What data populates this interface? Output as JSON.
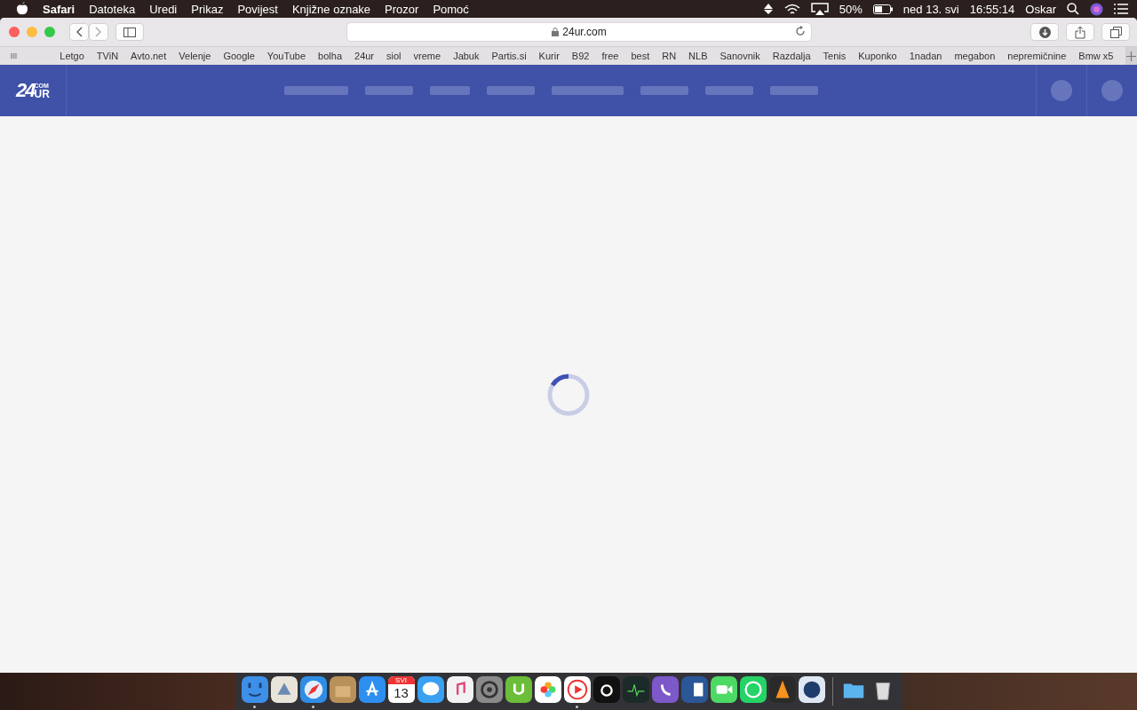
{
  "menu_bar": {
    "app_name": "Safari",
    "menus": [
      "Datoteka",
      "Uredi",
      "Prikaz",
      "Povijest",
      "Knjižne oznake",
      "Prozor",
      "Pomoć"
    ],
    "battery_percent": "50%",
    "date": "ned 13. svi",
    "time": "16:55:14",
    "user": "Oskar"
  },
  "toolbar": {
    "address": "24ur.com"
  },
  "bookmarks": [
    "Letgo",
    "TViN",
    "Avto.net",
    "Velenje",
    "Google",
    "YouTube",
    "bolha",
    "24ur",
    "siol",
    "vreme",
    "Jabuk",
    "Partis.si",
    "Kurir",
    "B92",
    "free",
    "best",
    "RN",
    "NLB",
    "Sanovnik",
    "Razdalja",
    "Tenis",
    "Kuponko",
    "1nadan",
    "megabon",
    "nepremičnine",
    "Bmw x5"
  ],
  "site_header": {
    "logo_number": "24",
    "logo_com": "COM",
    "logo_ur": "UR"
  },
  "loading": true,
  "dock": [
    {
      "kind": "finder",
      "running": true
    },
    {
      "kind": "mail",
      "running": false
    },
    {
      "kind": "safari",
      "running": true
    },
    {
      "kind": "archive",
      "running": false
    },
    {
      "kind": "appstore",
      "running": false
    },
    {
      "kind": "calendar",
      "running": false,
      "month": "SVI",
      "day": "13"
    },
    {
      "kind": "messages",
      "running": false
    },
    {
      "kind": "music",
      "running": false
    },
    {
      "kind": "settings",
      "running": false
    },
    {
      "kind": "torrent",
      "running": false
    },
    {
      "kind": "photos",
      "running": false
    },
    {
      "kind": "player",
      "running": true
    },
    {
      "kind": "camera",
      "running": false
    },
    {
      "kind": "monitor",
      "running": false
    },
    {
      "kind": "viber",
      "running": false
    },
    {
      "kind": "word",
      "running": false
    },
    {
      "kind": "facetime",
      "running": false
    },
    {
      "kind": "whatsapp",
      "running": false
    },
    {
      "kind": "vlc",
      "running": false
    },
    {
      "kind": "network",
      "running": false
    },
    {
      "kind": "separator",
      "running": false
    },
    {
      "kind": "folder",
      "running": false
    },
    {
      "kind": "trash",
      "running": false
    }
  ]
}
